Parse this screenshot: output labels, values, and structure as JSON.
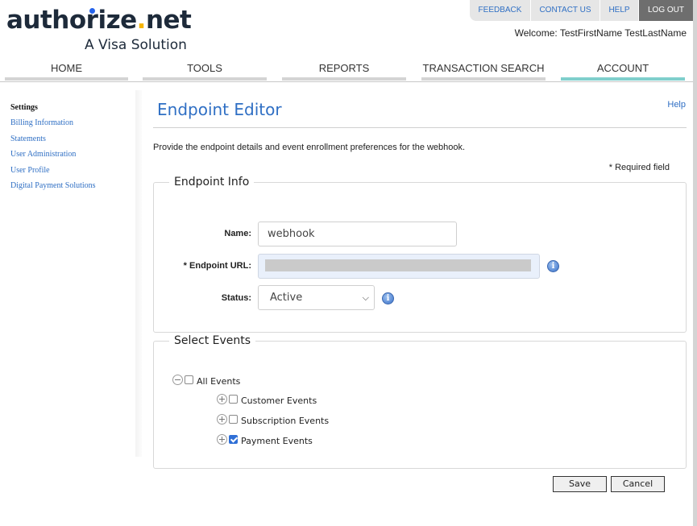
{
  "brand": {
    "logo_text_main": "authorize",
    "logo_text_dot": ".",
    "logo_text_tld": "net",
    "logo_subtitle": "A Visa Solution"
  },
  "utility_nav": {
    "items": [
      "FEEDBACK",
      "CONTACT US",
      "HELP"
    ],
    "logout": "LOG OUT"
  },
  "welcome": "Welcome: TestFirstName TestLastName",
  "main_nav": {
    "tabs": [
      {
        "label": "HOME",
        "active": false
      },
      {
        "label": "TOOLS",
        "active": false
      },
      {
        "label": "REPORTS",
        "active": false
      },
      {
        "label": "TRANSACTION SEARCH",
        "active": false
      },
      {
        "label": "ACCOUNT",
        "active": true
      }
    ],
    "active_color": "#7fcfcc"
  },
  "sidebar": {
    "heading": "Settings",
    "items": [
      "Billing Information",
      "Statements",
      "User Administration",
      "User Profile",
      "Digital Payment Solutions"
    ]
  },
  "page": {
    "title": "Endpoint Editor",
    "help_link": "Help",
    "intro": "Provide the endpoint details and event enrollment preferences for the webhook.",
    "required_note": "* Required field"
  },
  "endpoint_info": {
    "legend": "Endpoint Info",
    "name_label": "Name:",
    "name_value": "webhook",
    "url_label": "* Endpoint URL:",
    "url_value": "",
    "url_redacted": true,
    "status_label": "Status:",
    "status_value": "Active",
    "info_icon_glyph": "i"
  },
  "select_events": {
    "legend": "Select Events",
    "root": {
      "label": "All Events",
      "checked": false,
      "expanded": true
    },
    "children": [
      {
        "label": "Customer Events",
        "checked": false,
        "expanded": false
      },
      {
        "label": "Subscription Events",
        "checked": false,
        "expanded": false
      },
      {
        "label": "Payment Events",
        "checked": true,
        "expanded": false
      }
    ]
  },
  "actions": {
    "save": "Save",
    "cancel": "Cancel"
  },
  "colors": {
    "link_blue": "#2f6fc4",
    "logo_navy": "#1d2a3a",
    "logo_yellow": "#f5b400",
    "logout_bg": "#6e6e6e"
  }
}
